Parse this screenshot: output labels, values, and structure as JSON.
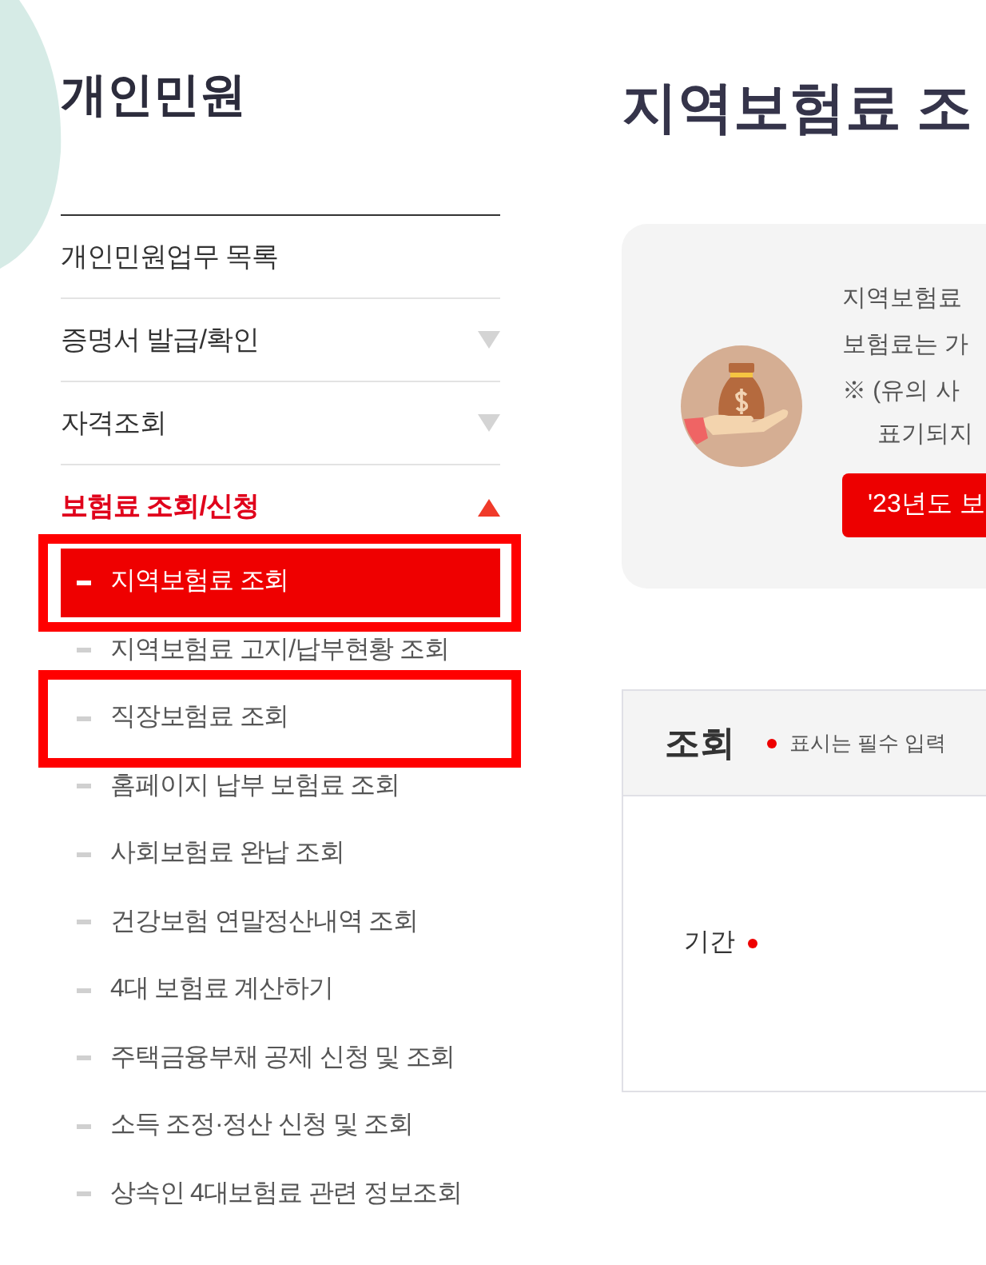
{
  "sidebar": {
    "title": "개인민원",
    "items": [
      {
        "label": "개인민원업무 목록",
        "kind": "link"
      },
      {
        "label": "증명서 발급/확인",
        "kind": "group",
        "expanded": false
      },
      {
        "label": "자격조회",
        "kind": "group",
        "expanded": false
      },
      {
        "label": "보험료 조회/신청",
        "kind": "group",
        "expanded": true,
        "children": [
          {
            "label": "지역보험료 조회",
            "selected": true,
            "highlighted": true
          },
          {
            "label": "지역보험료 고지/납부현황 조회",
            "selected": false,
            "highlighted": false
          },
          {
            "label": "직장보험료 조회",
            "selected": false,
            "highlighted": true
          },
          {
            "label": "홈페이지 납부 보험료 조회",
            "selected": false,
            "highlighted": false
          },
          {
            "label": "사회보험료 완납 조회",
            "selected": false,
            "highlighted": false
          },
          {
            "label": "건강보험 연말정산내역 조회",
            "selected": false,
            "highlighted": false
          },
          {
            "label": "4대 보험료 계산하기",
            "selected": false,
            "highlighted": false
          },
          {
            "label": "주택금융부채 공제 신청 및 조회",
            "selected": false,
            "highlighted": false
          },
          {
            "label": "소득 조정·정산 신청 및 조회",
            "selected": false,
            "highlighted": false
          },
          {
            "label": "상속인 4대보험료 관련 정보조회",
            "selected": false,
            "highlighted": false
          }
        ]
      }
    ]
  },
  "main": {
    "title": "지역보험료 조",
    "info": {
      "lines": [
        "지역보험료",
        "보험료는 가",
        "※ (유의 사",
        "표기되지"
      ],
      "button": "'23년도 보"
    },
    "form": {
      "title": "조회",
      "required_note": "표시는 필수 입력",
      "fields": [
        {
          "label": "기간",
          "required": true
        }
      ]
    }
  }
}
